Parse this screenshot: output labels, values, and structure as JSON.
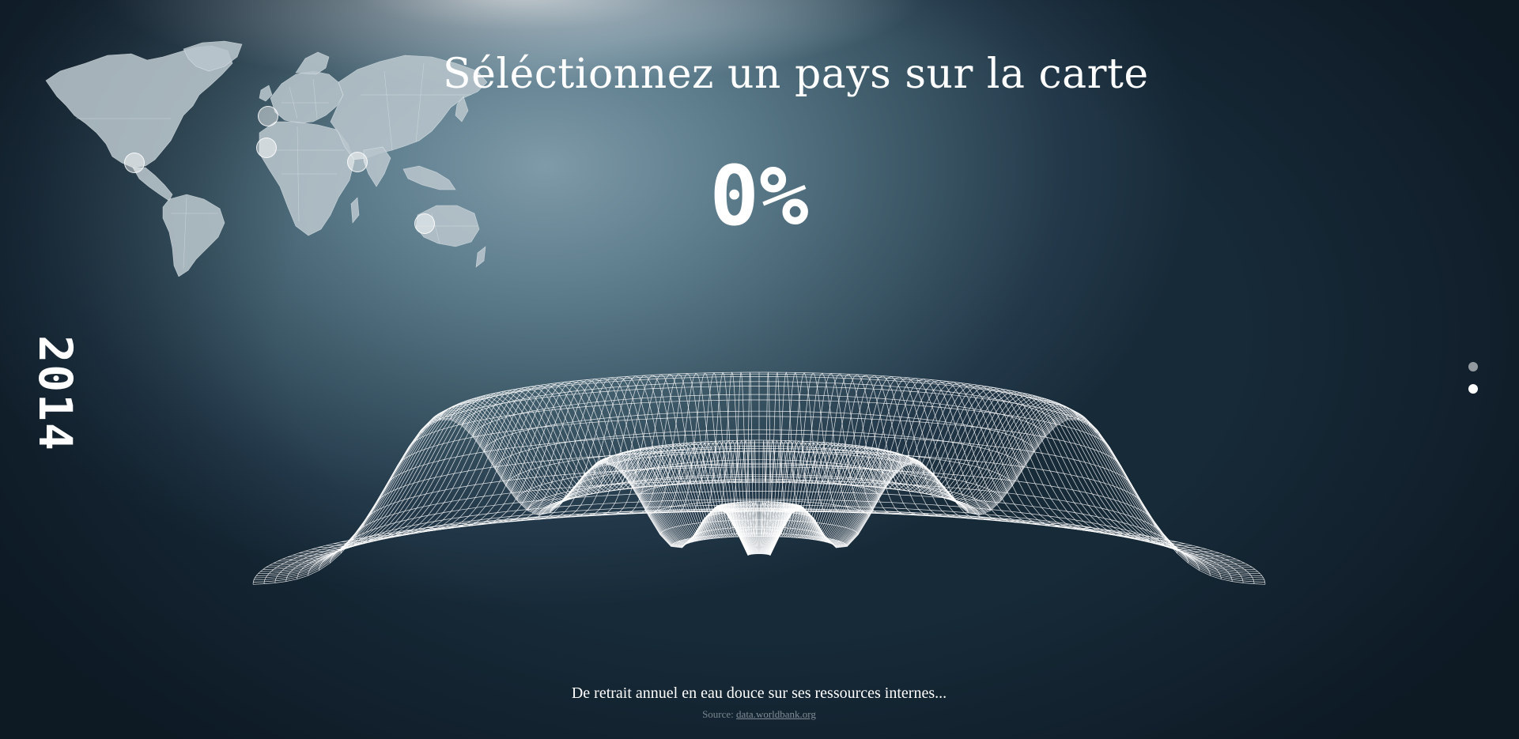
{
  "header": {
    "title": "Séléctionnez un pays sur la carte"
  },
  "metric": {
    "value_text": "0%",
    "year": "2014",
    "description": "De retrait annuel en eau douce sur ses ressources internes..."
  },
  "footer": {
    "source_label": "Source:",
    "source_link": "data.worldbank.org"
  },
  "map": {
    "markers": [
      "north-america",
      "europe",
      "north-africa",
      "south-asia",
      "australia"
    ]
  },
  "nav": {
    "dots": [
      {
        "state": "inactive"
      },
      {
        "state": "active"
      }
    ]
  },
  "colors": {
    "text": "#ffffff",
    "map_fill": "#b9c6cd",
    "mesh": "#ffffff",
    "background_dark": "#132532",
    "background_light": "#7f9aa8"
  }
}
